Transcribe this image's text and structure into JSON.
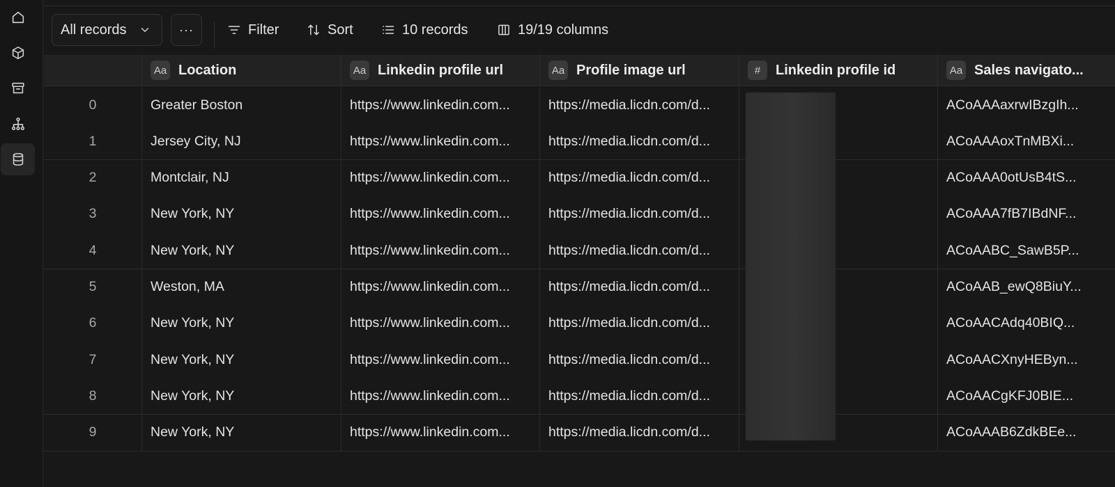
{
  "sidebar": {
    "items": [
      {
        "icon": "home-icon",
        "active": false
      },
      {
        "icon": "cube-icon",
        "active": false
      },
      {
        "icon": "archive-icon",
        "active": false
      },
      {
        "icon": "hierarchy-icon",
        "active": false
      },
      {
        "icon": "database-icon",
        "active": true
      }
    ]
  },
  "toolbar": {
    "view_label": "All records",
    "more_label": "···",
    "filter_label": "Filter",
    "sort_label": "Sort",
    "records_label": "10 records",
    "columns_label": "19/19 columns"
  },
  "table": {
    "columns": [
      {
        "type_icon": "Aa",
        "label": "Location"
      },
      {
        "type_icon": "Aa",
        "label": "Linkedin profile url"
      },
      {
        "type_icon": "Aa",
        "label": "Profile image url"
      },
      {
        "type_icon": "#",
        "label": "Linkedin profile id"
      },
      {
        "type_icon": "Aa",
        "label": "Sales navigato..."
      }
    ],
    "rows": [
      {
        "index": "0",
        "location": "Greater Boston",
        "linkedin_url": "https://www.linkedin.com...",
        "image_url": "https://media.licdn.com/d...",
        "profile_id": "",
        "sales_nav": "ACoAAAaxrwIBzgIh..."
      },
      {
        "index": "1",
        "location": "Jersey City, NJ",
        "linkedin_url": "https://www.linkedin.com...",
        "image_url": "https://media.licdn.com/d...",
        "profile_id": "",
        "sales_nav": "ACoAAAoxTnMBXi..."
      },
      {
        "index": "2",
        "location": "Montclair, NJ",
        "linkedin_url": "https://www.linkedin.com...",
        "image_url": "https://media.licdn.com/d...",
        "profile_id": "",
        "sales_nav": "ACoAAA0otUsB4tS..."
      },
      {
        "index": "3",
        "location": "New York, NY",
        "linkedin_url": "https://www.linkedin.com...",
        "image_url": "https://media.licdn.com/d...",
        "profile_id": "",
        "sales_nav": "ACoAAA7fB7IBdNF..."
      },
      {
        "index": "4",
        "location": "New York, NY",
        "linkedin_url": "https://www.linkedin.com...",
        "image_url": "https://media.licdn.com/d...",
        "profile_id": "",
        "sales_nav": "ACoAABC_SawB5P..."
      },
      {
        "index": "5",
        "location": "Weston, MA",
        "linkedin_url": "https://www.linkedin.com...",
        "image_url": "https://media.licdn.com/d...",
        "profile_id": "",
        "sales_nav": "ACoAAB_ewQ8BiuY..."
      },
      {
        "index": "6",
        "location": "New York, NY",
        "linkedin_url": "https://www.linkedin.com...",
        "image_url": "https://media.licdn.com/d...",
        "profile_id": "",
        "sales_nav": "ACoAACAdq40BIQ..."
      },
      {
        "index": "7",
        "location": "New York, NY",
        "linkedin_url": "https://www.linkedin.com...",
        "image_url": "https://media.licdn.com/d...",
        "profile_id": "",
        "sales_nav": "ACoAACXnyHEByn..."
      },
      {
        "index": "8",
        "location": "New York, NY",
        "linkedin_url": "https://www.linkedin.com...",
        "image_url": "https://media.licdn.com/d...",
        "profile_id": "",
        "sales_nav": "ACoAACgKFJ0BIE..."
      },
      {
        "index": "9",
        "location": "New York, NY",
        "linkedin_url": "https://www.linkedin.com...",
        "image_url": "https://media.licdn.com/d...",
        "profile_id": "",
        "sales_nav": "ACoAAAB6ZdkBEe..."
      }
    ]
  },
  "colors": {
    "background": "#181818",
    "header_bg": "#222222",
    "text": "#e6e6e6",
    "muted": "#a8a8a8"
  }
}
